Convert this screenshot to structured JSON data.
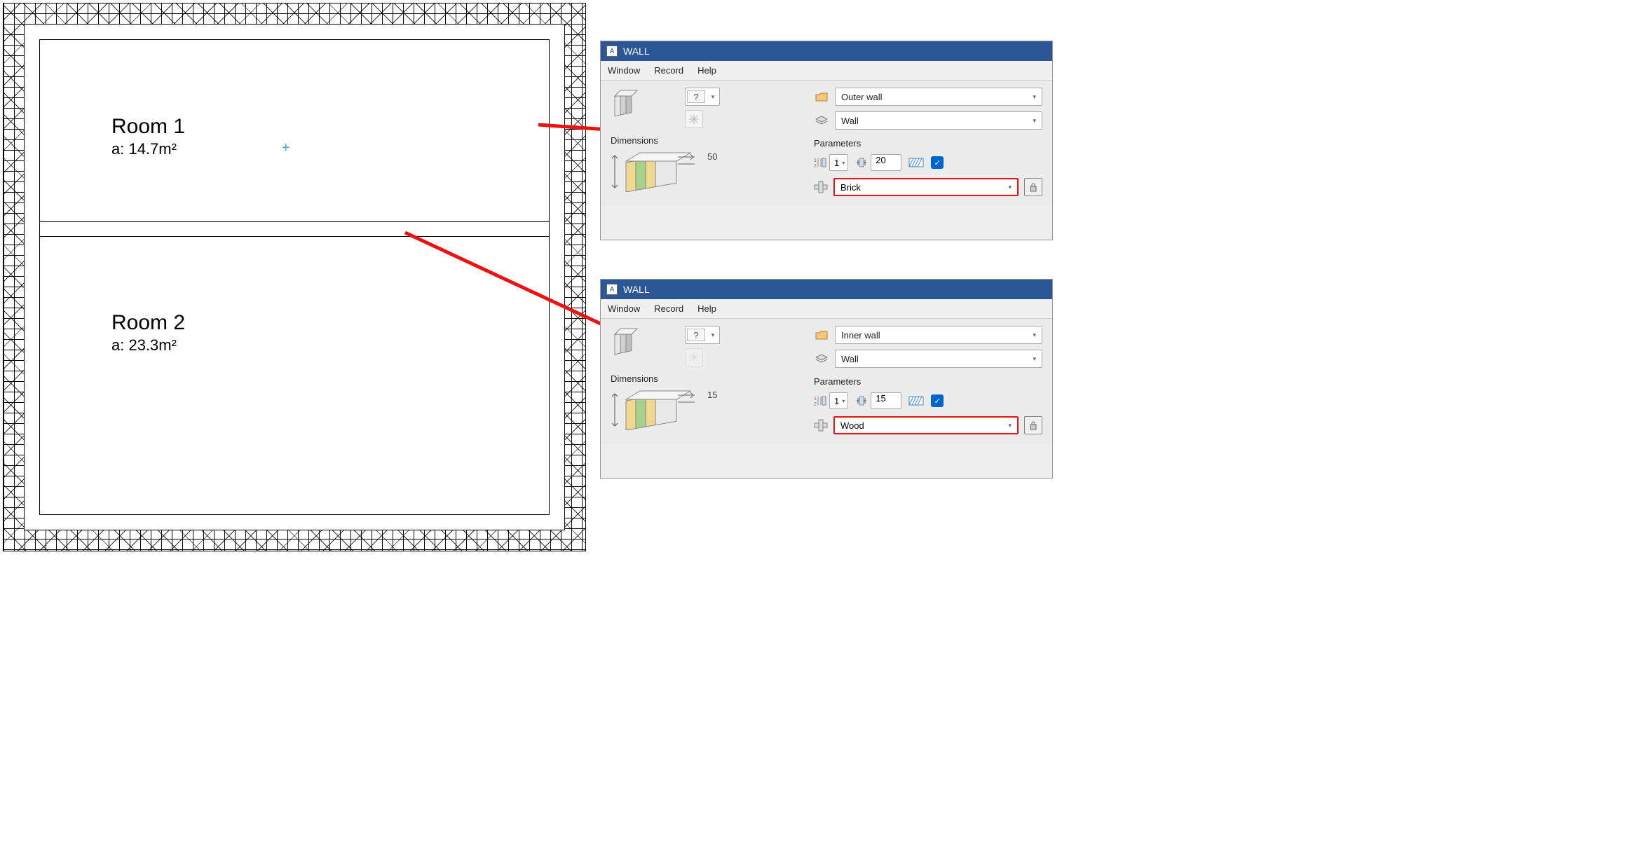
{
  "floorplan": {
    "room1": {
      "name": "Room 1",
      "area_label": "a: 14.7m²"
    },
    "room2": {
      "name": "Room 2",
      "area_label": "a: 23.3m²"
    }
  },
  "panel1": {
    "title": "WALL",
    "menu": {
      "window": "Window",
      "record": "Record",
      "help": "Help"
    },
    "dimensions_label": "Dimensions",
    "parameters_label": "Parameters",
    "type_value": "Outer wall",
    "layer_value": "Wall",
    "count_value": "1",
    "thickness_value": "20",
    "dim_value": "50",
    "material_value": "Brick",
    "question_mark": "?"
  },
  "panel2": {
    "title": "WALL",
    "menu": {
      "window": "Window",
      "record": "Record",
      "help": "Help"
    },
    "dimensions_label": "Dimensions",
    "parameters_label": "Parameters",
    "type_value": "Inner wall",
    "layer_value": "Wall",
    "count_value": "1",
    "thickness_value": "15",
    "dim_value": "15",
    "material_value": "Wood",
    "question_mark": "?"
  }
}
